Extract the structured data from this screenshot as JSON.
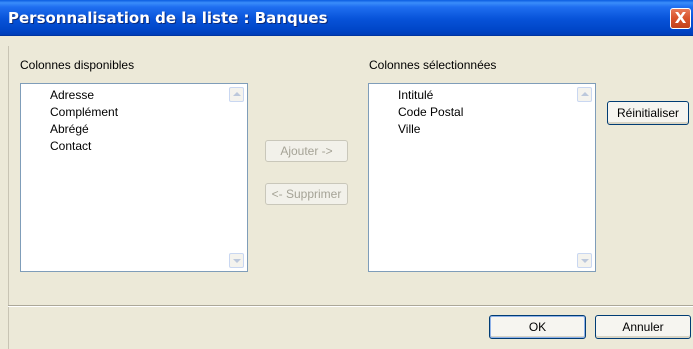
{
  "dialog": {
    "title": "Personnalisation de la liste : Banques",
    "close_glyph": "X"
  },
  "available": {
    "label": "Colonnes disponibles",
    "items": [
      "Adresse",
      "Complément",
      "Abrégé",
      "Contact"
    ]
  },
  "selected": {
    "label": "Colonnes sélectionnées",
    "items": [
      "Intitulé",
      "Code Postal",
      "Ville"
    ]
  },
  "buttons": {
    "add": "Ajouter ->",
    "remove": "<- Supprimer",
    "reset": "Réinitialiser",
    "ok": "OK",
    "cancel": "Annuler"
  },
  "icons": {
    "close": "close-icon",
    "scroll_up": "scroll-up-arrow-icon",
    "scroll_down": "scroll-down-arrow-icon"
  },
  "colors": {
    "titlebar": "#0752d8",
    "close": "#d8522a",
    "dialog_bg": "#ece9d8",
    "list_border": "#7f9db9"
  }
}
